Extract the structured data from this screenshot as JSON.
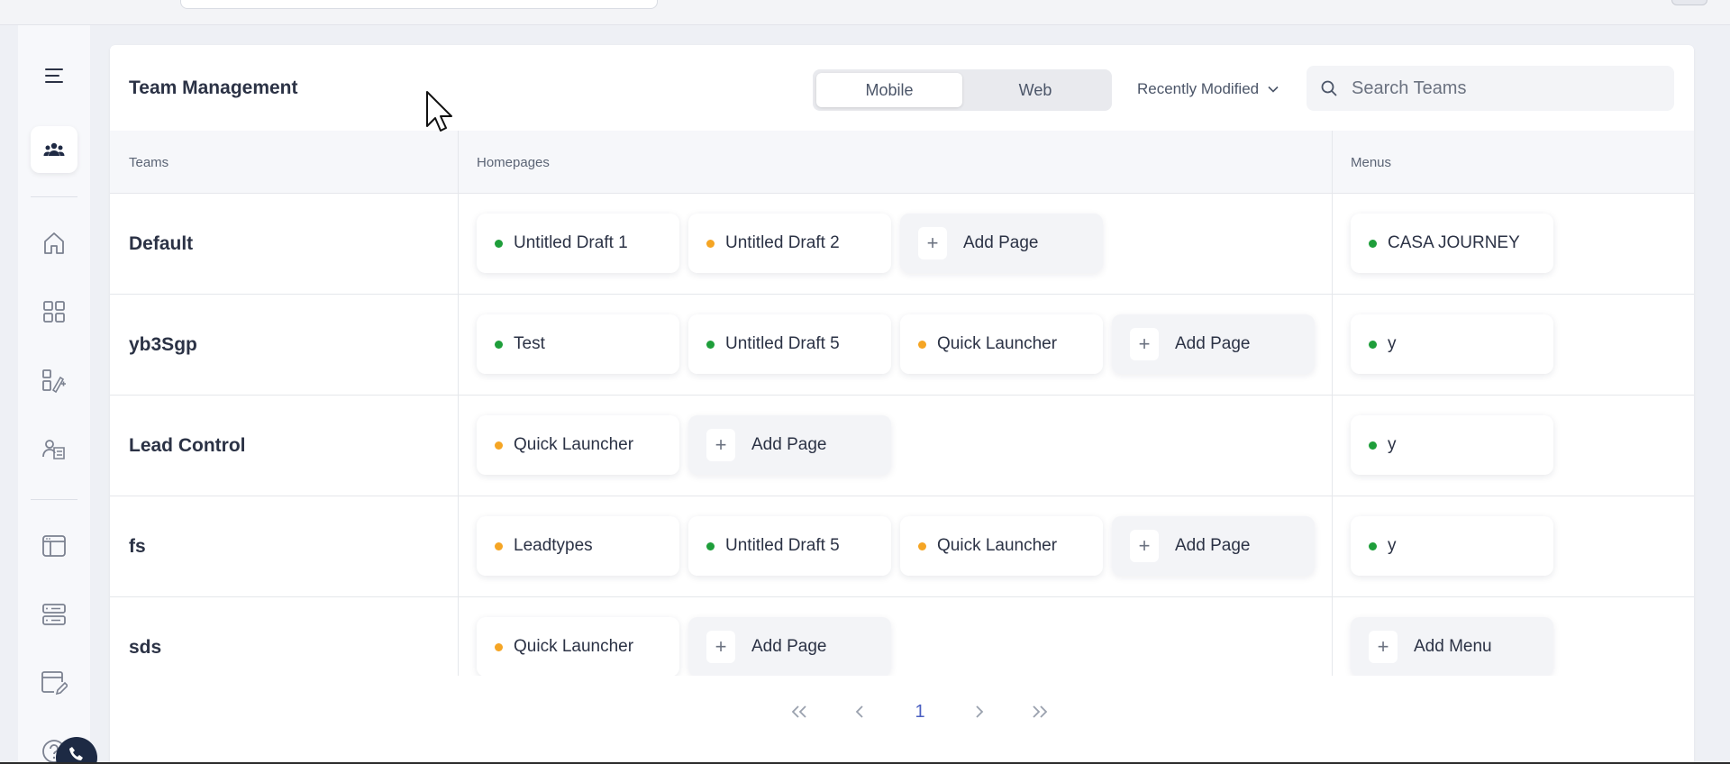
{
  "header": {
    "title": "Team Management",
    "platform_tabs": [
      {
        "label": "Mobile",
        "active": true
      },
      {
        "label": "Web",
        "active": false
      }
    ],
    "sort_label": "Recently Modified",
    "search_placeholder": "Search Teams"
  },
  "table": {
    "columns": [
      "Teams",
      "Homepages",
      "Menus"
    ],
    "rows": [
      {
        "team": "Default",
        "homepages": [
          {
            "label": "Untitled Draft 1",
            "status": "green"
          },
          {
            "label": "Untitled Draft 2",
            "status": "orange"
          }
        ],
        "homepage_add": "Add Page",
        "menus": [
          {
            "label": "CASA JOURNEY",
            "status": "green"
          }
        ],
        "menu_add": ""
      },
      {
        "team": "yb3Sgp",
        "homepages": [
          {
            "label": "Test",
            "status": "green"
          },
          {
            "label": "Untitled Draft 5",
            "status": "green"
          },
          {
            "label": "Quick Launcher",
            "status": "orange"
          }
        ],
        "homepage_add": "Add Page",
        "menus": [
          {
            "label": "y",
            "status": "green"
          }
        ],
        "menu_add": ""
      },
      {
        "team": "Lead Control",
        "homepages": [
          {
            "label": "Quick Launcher",
            "status": "orange"
          }
        ],
        "homepage_add": "Add Page",
        "menus": [
          {
            "label": "y",
            "status": "green"
          }
        ],
        "menu_add": ""
      },
      {
        "team": "fs",
        "homepages": [
          {
            "label": "Leadtypes",
            "status": "orange"
          },
          {
            "label": "Untitled Draft 5",
            "status": "green"
          },
          {
            "label": "Quick Launcher",
            "status": "orange"
          }
        ],
        "homepage_add": "Add Page",
        "menus": [
          {
            "label": "y",
            "status": "green"
          }
        ],
        "menu_add": ""
      },
      {
        "team": "sds",
        "homepages": [
          {
            "label": "Quick Launcher",
            "status": "orange"
          }
        ],
        "homepage_add": "Add Page",
        "menus": [],
        "menu_add": "Add Menu"
      }
    ]
  },
  "pagination": {
    "current_page": "1"
  },
  "sidebar": {
    "items": [
      {
        "icon": "menu-icon"
      },
      {
        "icon": "team-icon",
        "active": true
      },
      {
        "icon": "home-icon"
      },
      {
        "icon": "grid-icon"
      },
      {
        "icon": "page-builder-icon"
      },
      {
        "icon": "user-card-icon"
      },
      {
        "icon": "layout-icon"
      },
      {
        "icon": "server-icon"
      },
      {
        "icon": "web-edit-icon"
      },
      {
        "icon": "help-icon"
      }
    ]
  },
  "colors": {
    "status_green": "#1e9e3a",
    "status_orange": "#f5a524",
    "accent": "#4a5fc1"
  }
}
